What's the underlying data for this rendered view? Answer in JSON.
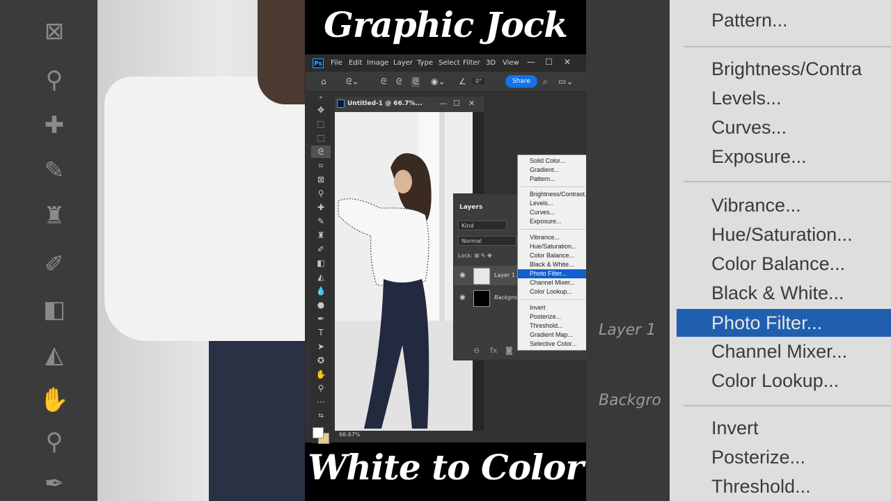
{
  "titles": {
    "top": "Graphic Jock",
    "bottom": "White to Color"
  },
  "menubar": {
    "logo": "Ps",
    "items": [
      "File",
      "Edit",
      "Image",
      "Layer",
      "Type",
      "Select",
      "Filter",
      "3D",
      "View"
    ],
    "window_buttons": [
      "—",
      "☐",
      "✕"
    ]
  },
  "options_bar": {
    "angle_value": "0°",
    "share_label": "Share"
  },
  "tools": [
    "move",
    "marquee",
    "lasso",
    "quick-select",
    "crop",
    "frame",
    "eyedropper",
    "healing",
    "brush",
    "stamp",
    "history-brush",
    "eraser",
    "gradient",
    "blur",
    "dodge",
    "pen",
    "type",
    "path-select",
    "shape",
    "hand",
    "zoom",
    "more"
  ],
  "document": {
    "title": "Untitled-1 @ 66.7%...",
    "zoom": "66.67%"
  },
  "layers_panel": {
    "tab": "Layers",
    "kind": "Kind",
    "blend_mode": "Normal",
    "lock_label": "Lock:",
    "layers": [
      {
        "name": "Layer 1"
      },
      {
        "name": "Backgro..."
      }
    ],
    "footer_icons": [
      "link",
      "fx",
      "mask"
    ]
  },
  "adjustment_menu": {
    "groups": [
      [
        "Solid Color...",
        "Gradient...",
        "Pattern..."
      ],
      [
        "Brightness/Contrast...",
        "Levels...",
        "Curves...",
        "Exposure..."
      ],
      [
        "Vibrance...",
        "Hue/Saturation...",
        "Color Balance...",
        "Black & White...",
        "Photo Filter...",
        "Channel Mixer...",
        "Color Lookup..."
      ],
      [
        "Invert",
        "Posterize...",
        "Threshold...",
        "Gradient Map...",
        "Selective Color..."
      ]
    ],
    "highlighted": "Photo Filter..."
  },
  "backdrop_right_menu": {
    "items": [
      "Pattern...",
      "Brightness/Contra",
      "Levels...",
      "Curves...",
      "Exposure...",
      "Vibrance...",
      "Hue/Saturation...",
      "Color Balance...",
      "Black & White...",
      "Photo Filter...",
      "Channel Mixer...",
      "Color Lookup...",
      "Invert",
      "Posterize...",
      "Threshold..."
    ],
    "layer_labels": [
      "Layer 1",
      "Backgro"
    ]
  },
  "colors": {
    "highlight": "#0f5fd0",
    "share": "#1473e6",
    "photoshop_blue": "#31a8ff",
    "foreground": "#ffffff",
    "background": "#e8c98a"
  }
}
